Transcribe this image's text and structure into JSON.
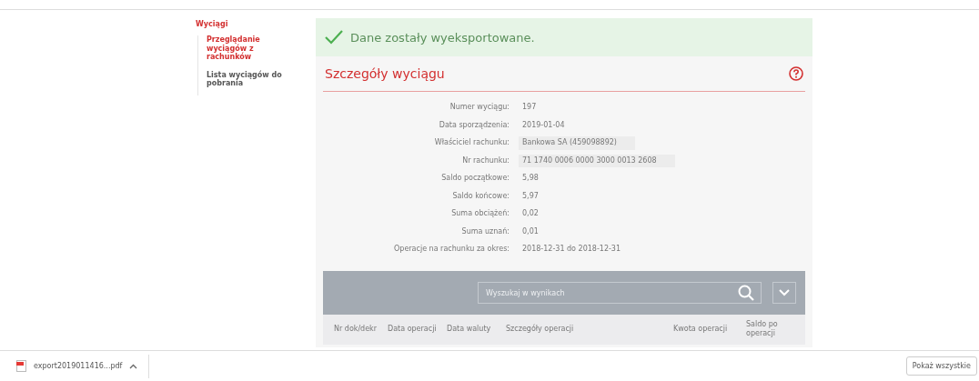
{
  "sidebar": {
    "title": "Wyciągi",
    "items": [
      {
        "label": "Przeglądanie wyciągów z rachunków",
        "selected": true
      },
      {
        "label": "Lista wyciągów do pobrania",
        "selected": false
      }
    ]
  },
  "alert": {
    "message": "Dane zostały wyeksportowane."
  },
  "panel": {
    "title": "Szczegóły wyciągu",
    "details": [
      {
        "label": "Numer wyciągu:",
        "value": "197",
        "highlighted": false
      },
      {
        "label": "Data sporządzenia:",
        "value": "2019-01-04",
        "highlighted": false
      },
      {
        "label": "Właściciel rachunku:",
        "value": "Bankowa SA (459098892)",
        "highlighted": true
      },
      {
        "label": "Nr rachunku:",
        "value": "71 1740 0006 0000 3000 0013 2608",
        "highlighted": true
      },
      {
        "label": "Saldo początkowe:",
        "value": "5,98",
        "highlighted": false
      },
      {
        "label": "Saldo końcowe:",
        "value": "5,97",
        "highlighted": false
      },
      {
        "label": "Suma obciążeń:",
        "value": "0,02",
        "highlighted": false
      },
      {
        "label": "Suma uznań:",
        "value": "0,01",
        "highlighted": false
      },
      {
        "label": "Operacje na rachunku za okres:",
        "value": "2018-12-31 do 2018-12-31",
        "highlighted": false
      }
    ]
  },
  "results": {
    "search": {
      "placeholder": "Wyszukaj w wynikach"
    },
    "columns": [
      "Nr dok/dekr",
      "Data operacji",
      "Data waluty",
      "Szczegóły operacji",
      "Kwota operacji",
      "Saldo po operacji"
    ]
  },
  "downloads": {
    "file": "export2019011416...pdf",
    "show_all": "Pokaż wszystkie"
  }
}
